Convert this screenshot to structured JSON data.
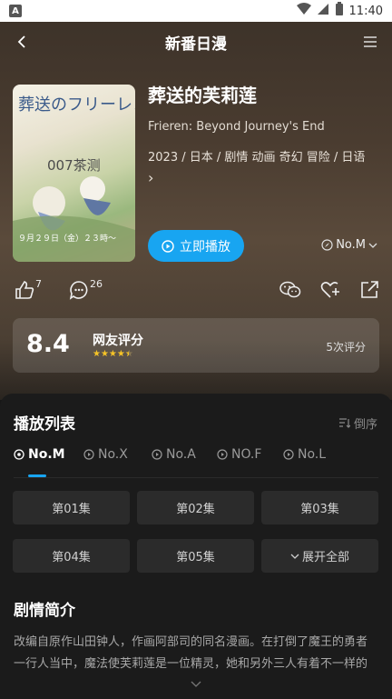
{
  "status": {
    "time": "11:40",
    "app_badge": "A"
  },
  "header": {
    "title": "新番日漫"
  },
  "anime": {
    "title": "葬送的芙莉莲",
    "original_title": "Frieren: Beyond Journey's End",
    "tags_line1": "2023 / 日本 / 剧情  动画  奇幻  冒险 / 日语",
    "tags_more": "›",
    "poster_title": "葬送のフリーレン",
    "poster_watermark": "007茶测",
    "poster_footer": "９月２９日（金）２３時～"
  },
  "play": {
    "label": "立即播放"
  },
  "source": {
    "selected": "No.M"
  },
  "actions": {
    "like_count": "7",
    "comment_count": "26"
  },
  "rating": {
    "score": "8.4",
    "label": "网友评分",
    "stars": 4.5,
    "count_text": "5次评分"
  },
  "playlist": {
    "title": "播放列表",
    "sort_label": "倒序",
    "sources": [
      "No.M",
      "No.X",
      "No.A",
      "NO.F",
      "No.L"
    ],
    "episodes": [
      "第01集",
      "第02集",
      "第03集",
      "第04集",
      "第05集"
    ],
    "expand_label": "展开全部"
  },
  "synopsis": {
    "title": "剧情简介",
    "line1": "改编自原作山田钟人，作画阿部司的同名漫画。在打倒了魔王的勇者",
    "line2": "一行人当中，魔法使芙莉莲是一位精灵，她和另外三人有着不一样的"
  },
  "colors": {
    "accent": "#18a5f1",
    "star": "#f6c427"
  }
}
